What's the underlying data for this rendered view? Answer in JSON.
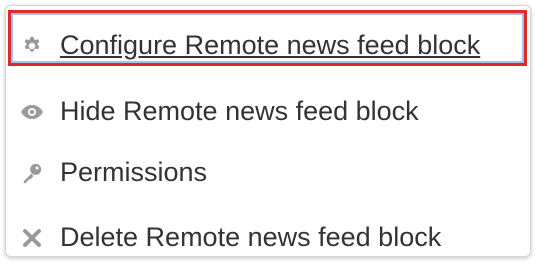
{
  "menu": {
    "items": [
      {
        "label": "Configure Remote news feed block",
        "icon": "gear-icon"
      },
      {
        "label": "Hide Remote news feed block",
        "icon": "eye-icon"
      },
      {
        "label": "Permissions",
        "icon": "key-icon"
      },
      {
        "label": "Delete Remote news feed block",
        "icon": "close-icon"
      }
    ],
    "icon_color": "#999999",
    "highlight_color": "#dd2b2b",
    "focus_ring_color": "#9ec4ea"
  }
}
